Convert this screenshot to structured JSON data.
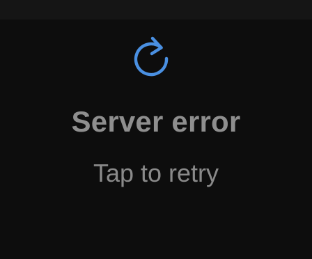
{
  "error_state": {
    "icon": "refresh-icon",
    "title": "Server error",
    "action_label": "Tap to retry"
  },
  "colors": {
    "background": "#0d0d0d",
    "top_bar": "#151515",
    "accent": "#4a90e2",
    "text_primary": "#8e8e8e",
    "text_secondary": "#8a8a8a"
  }
}
